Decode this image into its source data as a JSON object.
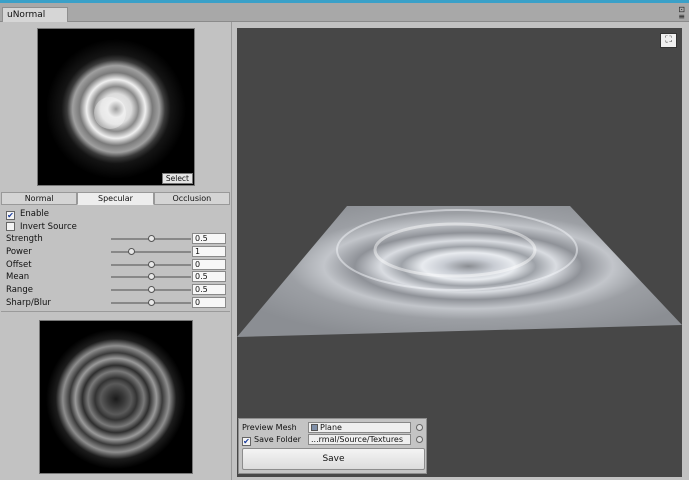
{
  "window": {
    "tab_title": "uNormal",
    "menu_icon": "≡",
    "lock_icon": "lock-icon"
  },
  "source_preview": {
    "select_label": "Select"
  },
  "mode_tabs": [
    {
      "label": "Normal",
      "active": false
    },
    {
      "label": "Specular",
      "active": true
    },
    {
      "label": "Occlusion",
      "active": false
    }
  ],
  "options": {
    "enable_label": "Enable",
    "enable_checked": true,
    "invert_label": "Invert Source",
    "invert_checked": false
  },
  "properties": [
    {
      "label": "Strength",
      "value": "0.5",
      "slider": 0.5
    },
    {
      "label": "Power",
      "value": "1",
      "slider": 0.25
    },
    {
      "label": "Offset",
      "value": "0",
      "slider": 0.5
    },
    {
      "label": "Mean",
      "value": "0.5",
      "slider": 0.5
    },
    {
      "label": "Range",
      "value": "0.5",
      "slider": 0.5
    },
    {
      "label": "Sharp/Blur",
      "value": "0",
      "slider": 0.5
    }
  ],
  "viewport": {
    "toggle_icon": "maximize-icon"
  },
  "bottom_panel": {
    "preview_mesh_label": "Preview Mesh",
    "preview_mesh_value": "Plane",
    "save_folder_label": "Save Folder",
    "save_folder_checked": true,
    "save_folder_value": "...rmal/Source/Textures",
    "save_button": "Save"
  },
  "colors": {
    "accent": "#3aa0c8",
    "panel_bg": "#c2c2c2",
    "viewport_bg": "#474747"
  }
}
